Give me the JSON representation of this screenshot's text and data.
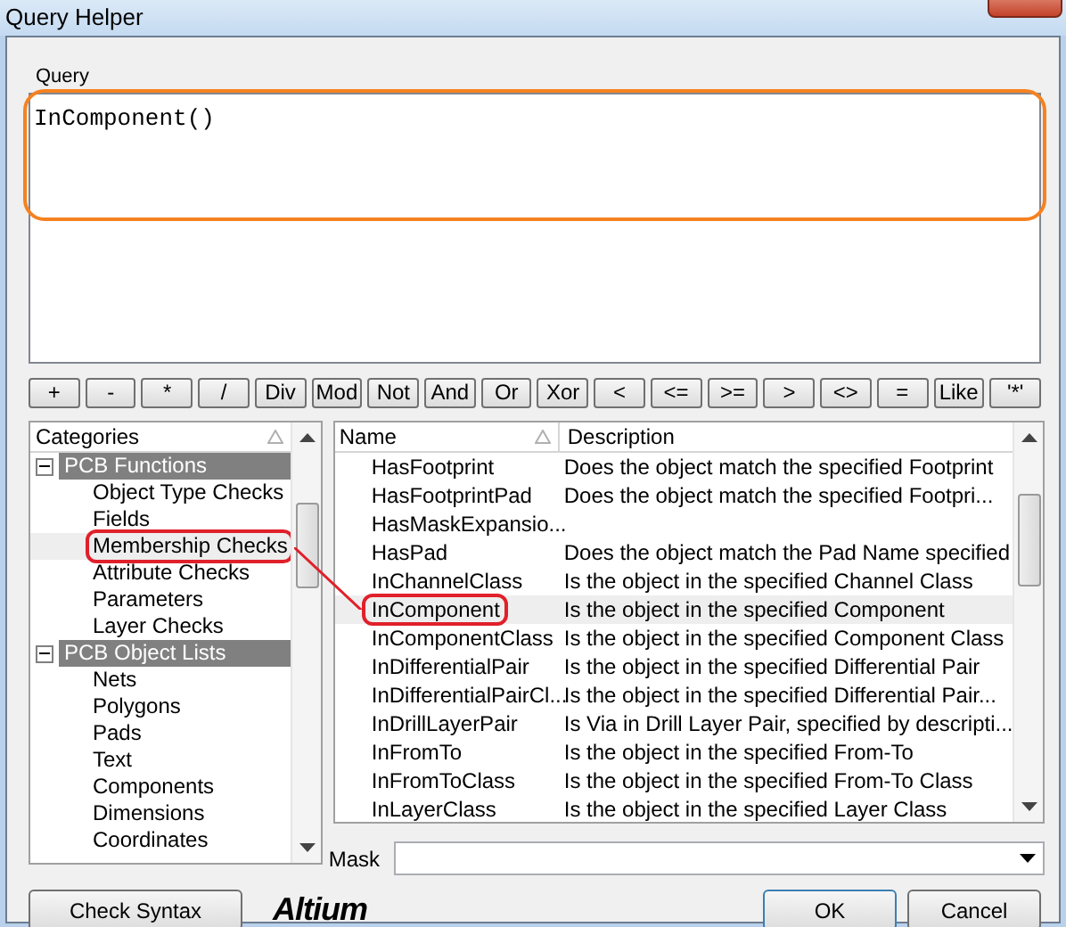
{
  "window": {
    "title": "Query Helper"
  },
  "query": {
    "label": "Query",
    "value": "InComponent()",
    "outlined": true
  },
  "operators": [
    "+",
    "-",
    "*",
    "/",
    "Div",
    "Mod",
    "Not",
    "And",
    "Or",
    "Xor",
    "<",
    "<=",
    ">=",
    ">",
    "<>",
    "=",
    "Like",
    "'*'"
  ],
  "categories": {
    "header": "Categories",
    "groups": [
      {
        "label": "PCB Functions",
        "expanded": true,
        "children": [
          {
            "label": "Object Type Checks",
            "selected": false,
            "circled": false
          },
          {
            "label": "Fields",
            "selected": false,
            "circled": false
          },
          {
            "label": "Membership Checks",
            "selected": true,
            "circled": true
          },
          {
            "label": "Attribute Checks",
            "selected": false,
            "circled": false
          },
          {
            "label": "Parameters",
            "selected": false,
            "circled": false
          },
          {
            "label": "Layer Checks",
            "selected": false,
            "circled": false
          }
        ]
      },
      {
        "label": "PCB Object Lists",
        "expanded": true,
        "children": [
          {
            "label": "Nets",
            "selected": false,
            "circled": false
          },
          {
            "label": "Polygons",
            "selected": false,
            "circled": false
          },
          {
            "label": "Pads",
            "selected": false,
            "circled": false
          },
          {
            "label": "Text",
            "selected": false,
            "circled": false
          },
          {
            "label": "Components",
            "selected": false,
            "circled": false
          },
          {
            "label": "Dimensions",
            "selected": false,
            "circled": false
          },
          {
            "label": "Coordinates",
            "selected": false,
            "circled": false
          }
        ]
      }
    ]
  },
  "functions": {
    "columns": [
      "Name",
      "Description"
    ],
    "rows": [
      {
        "name": "HasFootprint",
        "description": "Does the object match the specified Footprint",
        "selected": false,
        "circled": false
      },
      {
        "name": "HasFootprintPad",
        "description": "Does the object match the specified Footpri...",
        "selected": false,
        "circled": false
      },
      {
        "name": "HasMaskExpansio...",
        "selected": false,
        "circled": false
      },
      {
        "name": "HasPad",
        "description": "Does the object match the Pad Name specified",
        "selected": false,
        "circled": false
      },
      {
        "name": "InChannelClass",
        "description": "Is the object in the specified Channel Class",
        "selected": false,
        "circled": false
      },
      {
        "name": "InComponent",
        "description": "Is the object in the specified Component",
        "selected": true,
        "circled": true
      },
      {
        "name": "InComponentClass",
        "description": "Is the object in the specified Component Class",
        "selected": false,
        "circled": false
      },
      {
        "name": "InDifferentialPair",
        "description": "Is the object in the specified Differential Pair",
        "selected": false,
        "circled": false
      },
      {
        "name": "InDifferentialPairCl...",
        "description": "Is the object in the specified Differential Pair...",
        "selected": false,
        "circled": false
      },
      {
        "name": "InDrillLayerPair",
        "description": "Is Via in Drill Layer Pair, specified by descripti...",
        "selected": false,
        "circled": false
      },
      {
        "name": "InFromTo",
        "description": "Is the object in the specified From-To",
        "selected": false,
        "circled": false
      },
      {
        "name": "InFromToClass",
        "description": "Is the object in the specified From-To Class",
        "selected": false,
        "circled": false
      },
      {
        "name": "InLayerClass",
        "description": "Is the object in the specified Layer Class",
        "selected": false,
        "circled": false
      }
    ]
  },
  "mask": {
    "label": "Mask"
  },
  "buttons": {
    "check_syntax": "Check Syntax",
    "logo": "Altium",
    "ok": "OK",
    "cancel": "Cancel"
  }
}
